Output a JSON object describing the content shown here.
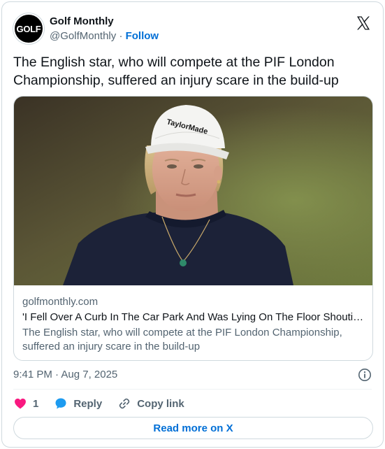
{
  "header": {
    "avatar_text": "GOLF",
    "author_name": "Golf Monthly",
    "handle": "@GolfMonthly",
    "separator": "·",
    "follow_label": "Follow"
  },
  "tweet": {
    "text": "The English star, who will compete at the PIF London Championship, suffered an injury scare in the build-up"
  },
  "link_card": {
    "image_alt": "Golfer wearing a white TaylorMade cap and navy sweater",
    "cap_brand": "TaylorMade",
    "domain": "golfmonthly.com",
    "title": "'I Fell Over A Curb In The Car Park And Was Lying On The Floor Shouting...",
    "description": "The English star, who will compete at the PIF London Championship, suffered an injury scare in the build-up"
  },
  "meta": {
    "timestamp": "9:41 PM · Aug 7, 2025"
  },
  "actions": {
    "like_count": "1",
    "reply_label": "Reply",
    "copy_label": "Copy link"
  },
  "footer": {
    "read_more_label": "Read more on X"
  },
  "colors": {
    "link_blue": "#006fd6",
    "like_red": "#f91880",
    "reply_blue": "#1d9bf0",
    "muted_gray": "#536471"
  },
  "icons": {
    "brand": "x-logo-icon",
    "info": "info-icon",
    "like": "heart-icon",
    "reply": "speech-bubble-icon",
    "copy": "link-icon"
  }
}
